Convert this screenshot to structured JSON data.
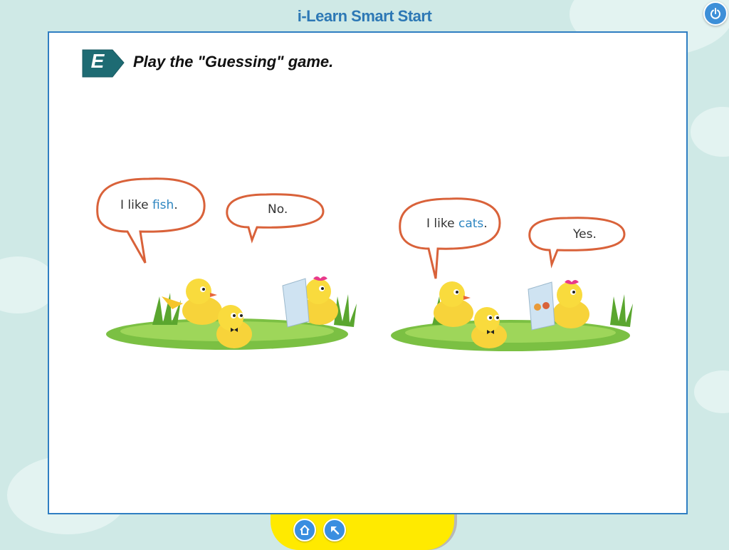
{
  "app": {
    "title": "i-Learn Smart Start"
  },
  "exercise": {
    "letter": "E",
    "instruction": "Play the \"Guessing\" game."
  },
  "scenes": [
    {
      "bubble_left": {
        "prefix": "I like ",
        "keyword": "fish",
        "suffix": "."
      },
      "bubble_right": {
        "text": "No."
      },
      "card": "blank-card"
    },
    {
      "bubble_left": {
        "prefix": "I like ",
        "keyword": "cats",
        "suffix": "."
      },
      "bubble_right": {
        "text": "Yes."
      },
      "card": "cats-card"
    }
  ],
  "icons": {
    "power": "power-icon",
    "home": "home-icon",
    "back": "back-arrow-icon"
  },
  "colors": {
    "title": "#2d78b5",
    "badge": "#1e6b73",
    "bubble_stroke": "#d9623a",
    "keyword": "#2e86c1",
    "bottom_bar": "#ffea00"
  }
}
